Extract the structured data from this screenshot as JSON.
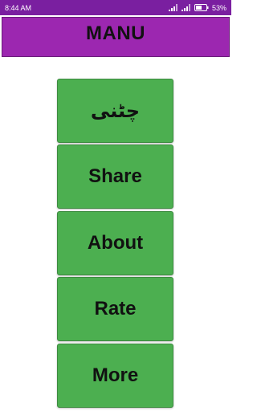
{
  "status_bar": {
    "time": "8:44 AM",
    "battery_percent": "53%"
  },
  "header": {
    "title": "MANU"
  },
  "menu": {
    "items": [
      {
        "label": "چٹنی"
      },
      {
        "label": "Share"
      },
      {
        "label": "About"
      },
      {
        "label": "Rate"
      },
      {
        "label": "More"
      }
    ]
  },
  "colors": {
    "status_bar": "#7a1fa0",
    "title_bar": "#9c27b0",
    "button": "#4caf50"
  }
}
